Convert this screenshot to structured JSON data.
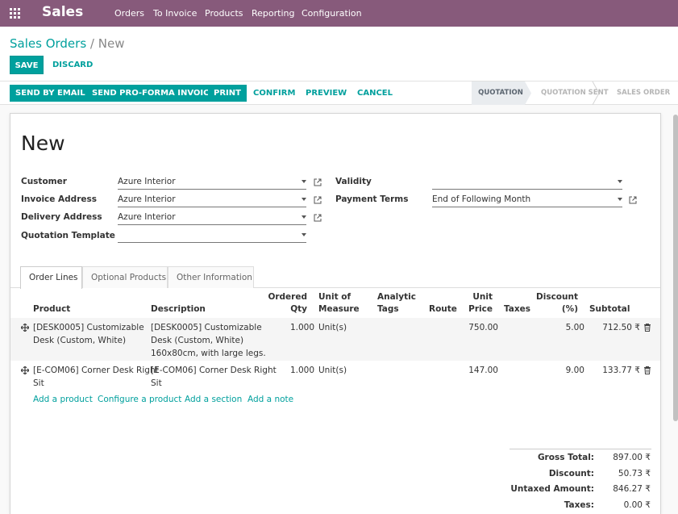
{
  "nav": {
    "app_name": "Sales",
    "menu": [
      "Orders",
      "To Invoice",
      "Products",
      "Reporting",
      "Configuration"
    ]
  },
  "breadcrumb": {
    "parent": "Sales Orders",
    "separator": "/",
    "current": "New"
  },
  "control": {
    "save_label": "SAVE",
    "discard_label": "DISCARD"
  },
  "statusbar": {
    "buttons": [
      "SEND BY EMAIL",
      "SEND PRO-FORMA INVOICE",
      "PRINT",
      "CONFIRM",
      "PREVIEW",
      "CANCEL"
    ],
    "stages": [
      "QUOTATION",
      "QUOTATION SENT",
      "SALES ORDER"
    ],
    "active_stage": "QUOTATION"
  },
  "form": {
    "title": "New",
    "customer_label": "Customer",
    "customer_value": "Azure Interior",
    "invoice_address_label": "Invoice Address",
    "invoice_address_value": "Azure Interior",
    "delivery_address_label": "Delivery Address",
    "delivery_address_value": "Azure Interior",
    "quotation_template_label": "Quotation Template",
    "quotation_template_value": "",
    "validity_label": "Validity",
    "validity_value": "",
    "payment_terms_label": "Payment Terms",
    "payment_terms_value": "End of Following Month"
  },
  "tabs": [
    "Order Lines",
    "Optional Products",
    "Other Information"
  ],
  "table": {
    "headers": {
      "product": "Product",
      "description": "Description",
      "ordered_1": "Ordered",
      "ordered_2": "Qty",
      "uom_1": "Unit of",
      "uom_2": "Measure",
      "tags_1": "Analytic",
      "tags_2": "Tags",
      "route": "Route",
      "price_1": "Unit",
      "price_2": "Price",
      "taxes": "Taxes",
      "discount_1": "Discount",
      "discount_2": "(%)",
      "subtotal": "Subtotal"
    },
    "rows": [
      {
        "product_1": "[DESK0005] Customizable",
        "product_2": "Desk (Custom, White)",
        "desc_1": "[DESK0005] Customizable",
        "desc_2": "Desk (Custom, White)",
        "desc_3": "160x80cm, with large legs.",
        "qty": "1.000",
        "uom": "Unit(s)",
        "price": "750.00",
        "discount": "5.00",
        "subtotal": "712.50 ₹"
      },
      {
        "product_1": "[E-COM06] Corner Desk Right",
        "product_2": "Sit",
        "desc_1": "[E-COM06] Corner Desk Right",
        "desc_2": "Sit",
        "qty": "1.000",
        "uom": "Unit(s)",
        "price": "147.00",
        "discount": "9.00",
        "subtotal": "133.77 ₹"
      }
    ],
    "add_links": [
      "Add a product",
      "Configure a product",
      "Add a section",
      "Add a note"
    ]
  },
  "totals": {
    "gross_label": "Gross Total:",
    "gross_value": "897.00 ₹",
    "discount_label": "Discount:",
    "discount_value": "50.73 ₹",
    "untaxed_label": "Untaxed Amount:",
    "untaxed_value": "846.27 ₹",
    "taxes_label": "Taxes:",
    "taxes_value": "0.00 ₹"
  },
  "colors": {
    "nav": "#875a7b",
    "primary": "#00a09d"
  }
}
